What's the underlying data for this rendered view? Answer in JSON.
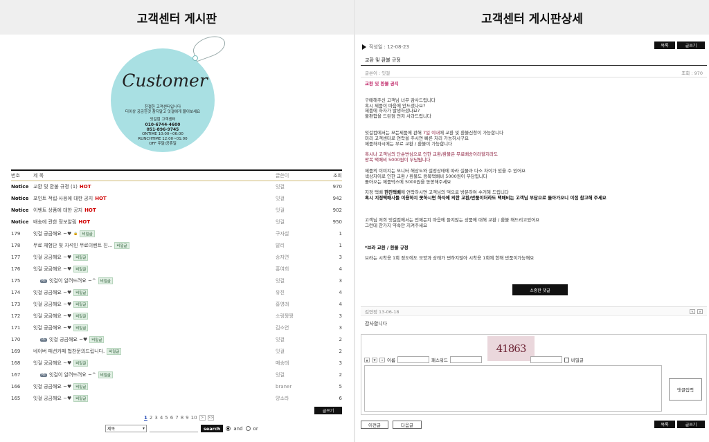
{
  "left": {
    "header": "고객센터 게시판",
    "tag": {
      "script": "Customer",
      "lines": [
        "친절한 고객센터입니다",
        "더이상 궁금한것 참지말고 잇걸에게 물어보세요"
      ],
      "center_name": "잇걸컴 고객센터",
      "phone1": "010-6744-4600",
      "phone2": "051-896-9745",
      "hours": [
        "ONTIME 10:00~06:00",
        "RUNCHTIME 12:00~01:00",
        "OFF 주말/공휴일"
      ]
    },
    "columns": {
      "no": "번호",
      "subject": "제 목",
      "writer": "글쓴이",
      "views": "조회"
    },
    "notices": [
      {
        "no": "Notice",
        "subject": "교환 및 환불 규정 (1)",
        "hot": "HOT",
        "writer": "잇걸",
        "views": "970"
      },
      {
        "no": "Notice",
        "subject": "포인트 적립·사용에 대한 공지",
        "hot": "HOT",
        "writer": "잇걸",
        "views": "942"
      },
      {
        "no": "Notice",
        "subject": "이벤트 상품에 대한 공지",
        "hot": "HOT",
        "writer": "잇걸",
        "views": "902"
      },
      {
        "no": "Notice",
        "subject": "배송에 관한 정보알림",
        "hot": "HOT",
        "writer": "잇걸",
        "views": "950"
      }
    ],
    "rows": [
      {
        "no": "179",
        "subject": "잇걸 궁금해요 ~♥",
        "badge": "비밀글",
        "writer": "구자설",
        "views": "1",
        "reply": false,
        "icon": true
      },
      {
        "no": "178",
        "subject": "무료 체험단 및 자석인 무료이벤트 진...",
        "badge": "비밀글",
        "writer": "말리",
        "views": "1",
        "reply": false,
        "icon": false
      },
      {
        "no": "177",
        "subject": "잇걸 궁금해요 ~♥",
        "badge": "비밀글",
        "writer": "송자연",
        "views": "3",
        "reply": false,
        "icon": false
      },
      {
        "no": "176",
        "subject": "잇걸 궁금해요 ~♥",
        "badge": "비밀글",
        "writer": "홍여희",
        "views": "4",
        "reply": false,
        "icon": false
      },
      {
        "no": "175",
        "subject": "잇걸이 알려드려요 ~^",
        "badge": "비밀글",
        "writer": "잇걸",
        "views": "3",
        "reply": true,
        "icon": false
      },
      {
        "no": "174",
        "subject": "잇걸 궁금해요 ~♥",
        "badge": "비밀글",
        "writer": "유진",
        "views": "4",
        "reply": false,
        "icon": false
      },
      {
        "no": "173",
        "subject": "잇걸 궁금해요 ~♥",
        "badge": "비밀글",
        "writer": "홍영래",
        "views": "4",
        "reply": false,
        "icon": false
      },
      {
        "no": "172",
        "subject": "잇걸 궁금해요 ~♥",
        "badge": "비밀글",
        "writer": "소링짱짱",
        "views": "3",
        "reply": false,
        "icon": false
      },
      {
        "no": "171",
        "subject": "잇걸 궁금해요 ~♥",
        "badge": "비밀글",
        "writer": "김소연",
        "views": "3",
        "reply": false,
        "icon": false
      },
      {
        "no": "170",
        "subject": "잇걸 궁금해요 ~♥",
        "badge": "비밀글",
        "writer": "잇걸",
        "views": "2",
        "reply": true,
        "icon": false
      },
      {
        "no": "169",
        "subject": "네이버 패션카페 협찬문의드립니다.",
        "badge": "비밀글",
        "writer": "잇걸",
        "views": "2",
        "reply": false,
        "icon": false
      },
      {
        "no": "168",
        "subject": "잇걸 궁금해요 ~♥",
        "badge": "비밀글",
        "writer": "매송태",
        "views": "3",
        "reply": false,
        "icon": false
      },
      {
        "no": "167",
        "subject": "잇걸이 알려드려요 ~^",
        "badge": "비밀글",
        "writer": "잇걸",
        "views": "2",
        "reply": true,
        "icon": false
      },
      {
        "no": "166",
        "subject": "잇걸 궁금해요 ~♥",
        "badge": "비밀글",
        "writer": "braner",
        "views": "5",
        "reply": false,
        "icon": false
      },
      {
        "no": "165",
        "subject": "잇걸 궁금해요 ~♥",
        "badge": "비밀글",
        "writer": "양소라",
        "views": "6",
        "reply": false,
        "icon": false
      }
    ],
    "write_label": "글쓰기",
    "reply_tag": "RE",
    "pages": [
      "1",
      "2",
      "3",
      "4",
      "5",
      "6",
      "7",
      "8",
      "9",
      "10"
    ],
    "search": {
      "select_value": "제목",
      "button": "search",
      "opt_and": "and",
      "opt_or": "or"
    }
  },
  "right": {
    "header": "고객센터 게시판상세",
    "date": "작성일 : 12-08-23",
    "list_btn": "목록",
    "write_btn": "글쓰기",
    "title": "교환 및 환불 규정",
    "writer": "글쓴이 : 잇걸",
    "views": "조회 : 970",
    "content": {
      "heading": "교환 및 환불 공지",
      "p1": [
        "구매해주신 고객님 너무 감사드립니다",
        "혹시 제품이 마음에 안드셨나요?",
        "제품에 하자가 발생하셨나요?",
        "불편함을 드린점 먼저 사과드립니다"
      ],
      "p2_a": "잇걸컴에서는 모든제품에 관해 ",
      "p2_red": "7일 이내",
      "p2_b": "에 교환 및 환불신청이 가능합니다",
      "p2": [
        "미리 고객센터로 연락을 주시면 빠른 처리 가능하시구요",
        "제품하자시에는 무료 교환 / 환불이 가능합니다"
      ],
      "p3": [
        "혹시나 고객님의 단순변심으로 인한 교환/환불은 무료배송이라할지라도",
        "왕복 택배비 5000원이 부담됩니다"
      ],
      "p4": [
        "제품의 이미지는 모니터 해상도와 설정상태에 따라 실물과 다소 차이가 있을 수 있어요",
        "색상차이로 인한 교환 / 환불도 왕복택배비 5000원이 부담됩니다",
        "돌아오는 제품박스에 5000원을 동봉해주세요"
      ],
      "p5a_pre": "지정 택배 ",
      "p5a_bold": "한진택배",
      "p5a_post": "에 연락하시면 고객님의 댁으로 방문하여 수거해 드립니다",
      "p5b": "혹시 지정택배사를 이용하지 못하시면 하자에 의한 교환/반품이더라도 택배비는 고객님 부담으로 돌아가오니 이점 참고해 주세요",
      "p6": [
        "고객님 저희 잇걸컴에서는 언제든지 마음에 들지않는 상품에 대해 교환 / 환불 해드리고있어요",
        "그런데 한가지 약속만 지켜주세요"
      ],
      "p7_title": "*브라 교환 / 환불 규정",
      "p7": "브라는 시착용 1회 정도에도 모양과 상태가 변하지않아 시착용 1회에 한해 반품이가능해요"
    },
    "reply_btn": "소중한 댓글",
    "comment": {
      "author": "김연정 13-06-18",
      "text": "감사합니다"
    },
    "form": {
      "captcha": "41863",
      "name_label": "이름",
      "pw_label": "패스워드",
      "secret_label": "비밀글",
      "submit": "댓글입력"
    },
    "prev_btn": "이전글",
    "next_btn": "다음글"
  }
}
